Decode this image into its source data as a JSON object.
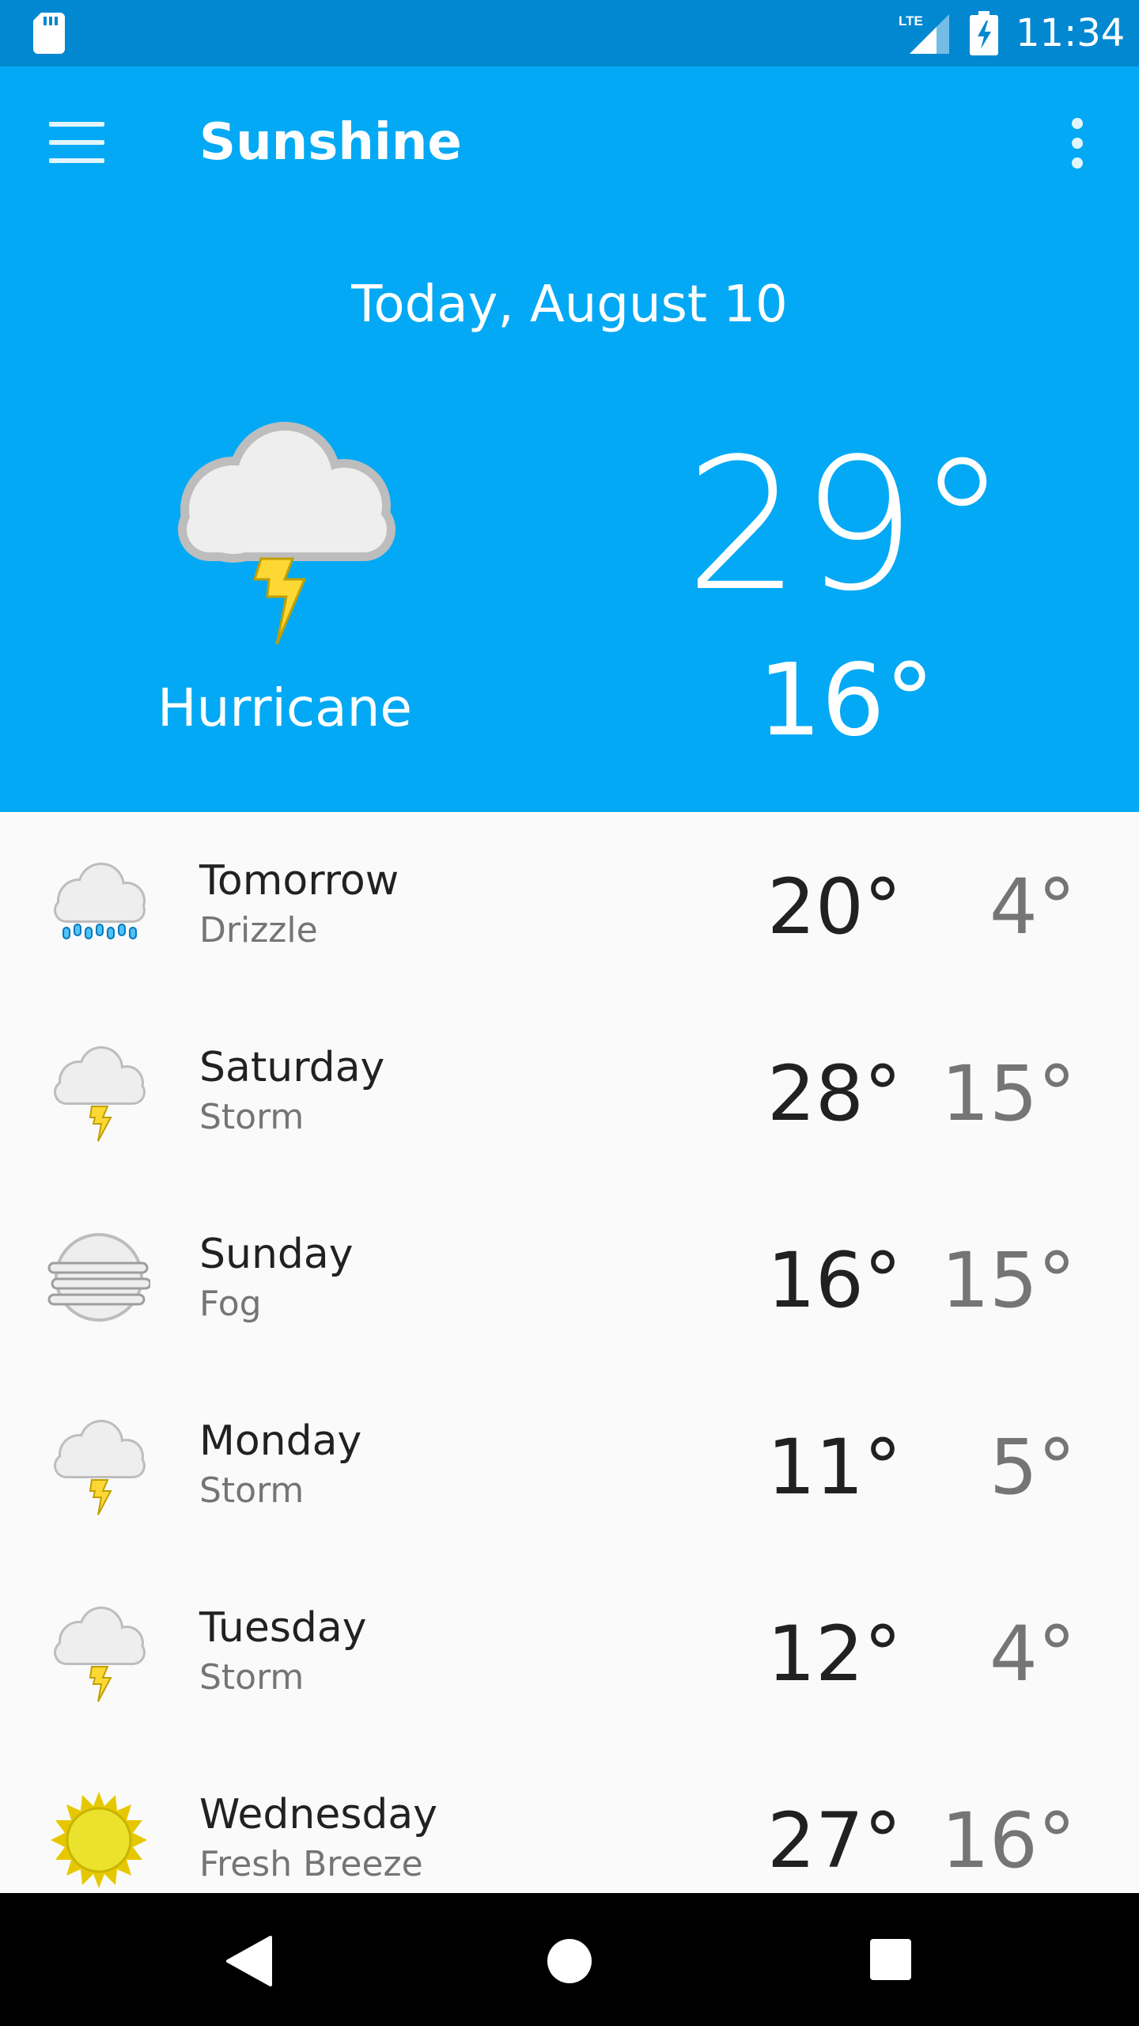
{
  "status_bar": {
    "time": "11:34",
    "network_label": "LTE",
    "icons": [
      "sd-card-icon",
      "lte-signal-icon",
      "battery-charging-icon"
    ]
  },
  "toolbar": {
    "title": "Sunshine",
    "menu_icon": "hamburger-menu-icon",
    "overflow_icon": "overflow-menu-icon"
  },
  "today": {
    "date": "Today, August 10",
    "high": "29°",
    "low": "16°",
    "description": "Hurricane",
    "icon": "storm-icon"
  },
  "forecast": [
    {
      "day": "Tomorrow",
      "description": "Drizzle",
      "high": "20°",
      "low": "4°",
      "icon": "drizzle-icon"
    },
    {
      "day": "Saturday",
      "description": "Storm",
      "high": "28°",
      "low": "15°",
      "icon": "storm-icon"
    },
    {
      "day": "Sunday",
      "description": "Fog",
      "high": "16°",
      "low": "15°",
      "icon": "fog-icon"
    },
    {
      "day": "Monday",
      "description": "Storm",
      "high": "11°",
      "low": "5°",
      "icon": "storm-icon"
    },
    {
      "day": "Tuesday",
      "description": "Storm",
      "high": "12°",
      "low": "4°",
      "icon": "storm-icon"
    },
    {
      "day": "Wednesday",
      "description": "Fresh Breeze",
      "high": "27°",
      "low": "16°",
      "icon": "sun-icon"
    }
  ],
  "nav_bar": {
    "buttons": [
      "back-icon",
      "home-icon",
      "recents-icon"
    ]
  },
  "colors": {
    "status_bar": "#0288d1",
    "primary": "#03a9f4",
    "list_background": "#fafafa",
    "primary_text": "#212121",
    "secondary_text": "#757575"
  }
}
